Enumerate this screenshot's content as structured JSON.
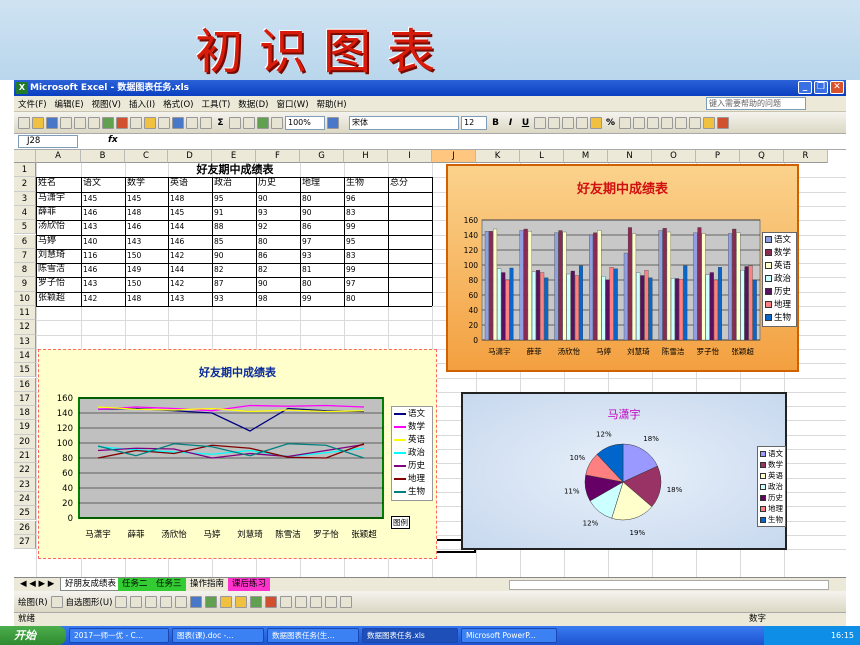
{
  "slide_title": "初识图表",
  "window": {
    "title": "Microsoft Excel - 数据图表任务.xls",
    "app_icon": "excel-icon"
  },
  "menu": [
    "文件(F)",
    "编辑(E)",
    "视图(V)",
    "插入(I)",
    "格式(O)",
    "工具(T)",
    "数据(D)",
    "窗口(W)",
    "帮助(H)"
  ],
  "help_placeholder": "键入需要帮助的问题",
  "toolbar": {
    "zoom": "100%",
    "font": "宋体",
    "size": "12",
    "bold": "B",
    "italic": "I",
    "underline": "U",
    "sigma": "Σ",
    "percent": "%"
  },
  "formula": {
    "name_box": "J28",
    "fx": "fx"
  },
  "columns": [
    "A",
    "B",
    "C",
    "D",
    "E",
    "F",
    "G",
    "H",
    "I",
    "J",
    "K",
    "L",
    "M",
    "N",
    "O",
    "P",
    "Q",
    "R"
  ],
  "rows": [
    "1",
    "2",
    "3",
    "4",
    "5",
    "6",
    "7",
    "8",
    "9",
    "10",
    "11",
    "12",
    "13",
    "14",
    "15",
    "16",
    "17",
    "18",
    "19",
    "20",
    "21",
    "22",
    "23",
    "24",
    "25",
    "26",
    "27"
  ],
  "table": {
    "title": "好友期中成绩表",
    "headers": [
      "姓名",
      "语文",
      "数学",
      "英语",
      "政治",
      "历史",
      "地理",
      "生物",
      "总分"
    ],
    "rows": [
      [
        "马潇宇",
        "145",
        "145",
        "148",
        "95",
        "90",
        "80",
        "96",
        ""
      ],
      [
        "薛菲",
        "146",
        "148",
        "145",
        "91",
        "93",
        "90",
        "83",
        ""
      ],
      [
        "汤欣怡",
        "143",
        "146",
        "144",
        "88",
        "92",
        "86",
        "99",
        ""
      ],
      [
        "马婷",
        "140",
        "143",
        "146",
        "85",
        "80",
        "97",
        "95",
        ""
      ],
      [
        "刘慧琦",
        "116",
        "150",
        "142",
        "90",
        "86",
        "93",
        "83",
        ""
      ],
      [
        "陈雪洁",
        "146",
        "149",
        "144",
        "82",
        "82",
        "81",
        "99",
        ""
      ],
      [
        "罗子怡",
        "143",
        "150",
        "142",
        "87",
        "90",
        "80",
        "97",
        ""
      ],
      [
        "张颖超",
        "142",
        "148",
        "143",
        "93",
        "98",
        "99",
        "80",
        ""
      ]
    ]
  },
  "chart_data": [
    {
      "type": "bar",
      "title": "好友期中成绩表",
      "categories": [
        "马潇宇",
        "薛菲",
        "汤欣怡",
        "马婷",
        "刘慧琦",
        "陈雪洁",
        "罗子怡",
        "张颖超"
      ],
      "ylim": [
        0,
        160
      ],
      "yticks": [
        "0",
        "20",
        "40",
        "60",
        "80",
        "100",
        "120",
        "140",
        "160"
      ],
      "legend_position": "right",
      "series": [
        {
          "name": "语文",
          "color": "#8f9fdf",
          "values": [
            145,
            146,
            143,
            140,
            116,
            146,
            143,
            142
          ]
        },
        {
          "name": "数学",
          "color": "#8b2a52",
          "values": [
            145,
            148,
            146,
            143,
            150,
            149,
            150,
            148
          ]
        },
        {
          "name": "英语",
          "color": "#ffffcc",
          "values": [
            148,
            145,
            144,
            146,
            142,
            144,
            142,
            143
          ]
        },
        {
          "name": "政治",
          "color": "#ccffff",
          "values": [
            95,
            91,
            88,
            85,
            90,
            82,
            87,
            93
          ]
        },
        {
          "name": "历史",
          "color": "#5a1060",
          "values": [
            90,
            93,
            92,
            80,
            86,
            82,
            90,
            98
          ]
        },
        {
          "name": "地理",
          "color": "#ff8080",
          "values": [
            80,
            90,
            86,
            97,
            93,
            81,
            80,
            99
          ]
        },
        {
          "name": "生物",
          "color": "#0a66c8",
          "values": [
            96,
            83,
            99,
            95,
            83,
            99,
            97,
            80
          ]
        }
      ]
    },
    {
      "type": "line",
      "title": "好友期中成绩表",
      "categories": [
        "马潇宇",
        "薛菲",
        "汤欣怡",
        "马婷",
        "刘慧琦",
        "陈雪洁",
        "罗子怡",
        "张颖超"
      ],
      "ylim": [
        0,
        160
      ],
      "yticks": [
        "0",
        "20",
        "40",
        "60",
        "80",
        "100",
        "120",
        "140",
        "160"
      ],
      "legend_position": "right",
      "legend_footer": "图例",
      "series": [
        {
          "name": "语文",
          "color": "#000080",
          "values": [
            145,
            146,
            143,
            140,
            116,
            146,
            143,
            142
          ]
        },
        {
          "name": "数学",
          "color": "#ff00ff",
          "values": [
            145,
            148,
            146,
            143,
            150,
            149,
            150,
            148
          ]
        },
        {
          "name": "英语",
          "color": "#ffff00",
          "values": [
            148,
            145,
            144,
            146,
            142,
            144,
            142,
            143
          ]
        },
        {
          "name": "政治",
          "color": "#00ffff",
          "values": [
            95,
            91,
            88,
            85,
            90,
            82,
            87,
            93
          ]
        },
        {
          "name": "历史",
          "color": "#800080",
          "values": [
            90,
            93,
            92,
            80,
            86,
            82,
            90,
            98
          ]
        },
        {
          "name": "地理",
          "color": "#800000",
          "values": [
            80,
            90,
            86,
            97,
            93,
            81,
            80,
            99
          ]
        },
        {
          "name": "生物",
          "color": "#008080",
          "values": [
            96,
            83,
            99,
            95,
            83,
            99,
            97,
            80
          ]
        }
      ]
    },
    {
      "type": "pie",
      "title": "马潇宇",
      "legend_position": "right",
      "categories": [
        "语文",
        "数学",
        "英语",
        "政治",
        "历史",
        "地理",
        "生物"
      ],
      "values": [
        145,
        145,
        148,
        95,
        90,
        80,
        96
      ],
      "labels": [
        "18%",
        "18%",
        "19%",
        "12%",
        "11%",
        "10%",
        "12%"
      ],
      "colors": [
        "#9999ff",
        "#993366",
        "#ffffcc",
        "#ccffff",
        "#660066",
        "#ff8080",
        "#0066cc"
      ]
    }
  ],
  "sheet_tabs": {
    "nav": "◀ ◀ ▶ ▶",
    "active": "好朋友成绩表",
    "others": [
      "任务二",
      "任务三",
      "操作指南",
      "课后练习"
    ]
  },
  "drawing_bar": {
    "draw": "绘图(R)",
    "autoshapes": "自选图形(U)"
  },
  "status": {
    "left": "就绪",
    "right": "数字"
  },
  "taskbar": {
    "start": "开始",
    "tasks": [
      "2017一师一优 - C...",
      "图表(课).doc -...",
      "数据图表任务(生...",
      "数据图表任务.xls",
      "Microsoft PowerP..."
    ],
    "active_index": 3,
    "time": "16:15"
  }
}
